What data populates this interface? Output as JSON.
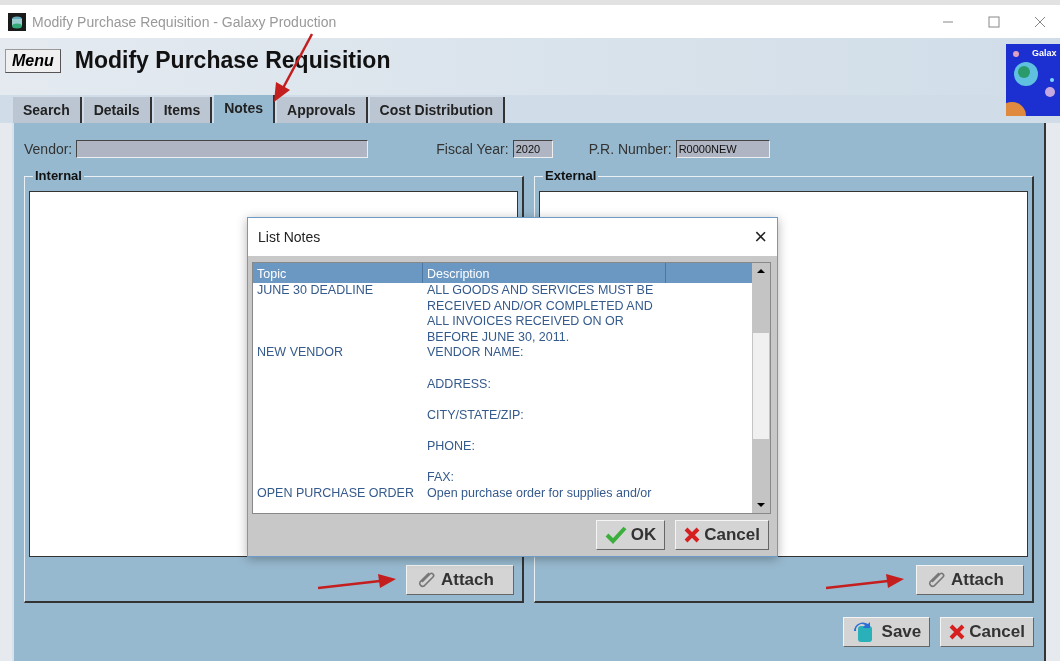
{
  "window": {
    "title": "Modify Purchase Requisition - Galaxy Production"
  },
  "header": {
    "menu_button": "Menu",
    "title": "Modify Purchase Requisition",
    "logo_text": "Galax"
  },
  "tabs": [
    {
      "label": "Search",
      "selected": false
    },
    {
      "label": "Details",
      "selected": false
    },
    {
      "label": "Items",
      "selected": false
    },
    {
      "label": "Notes",
      "selected": true
    },
    {
      "label": "Approvals",
      "selected": false
    },
    {
      "label": "Cost Distribution",
      "selected": false
    }
  ],
  "fields": {
    "vendor_label": "Vendor:",
    "fiscal_year_label": "Fiscal Year:",
    "fiscal_year": "2020",
    "pr_number_label": "P.R. Number:",
    "pr_number": "R0000NEW"
  },
  "groups": [
    {
      "title": "Internal",
      "attach": "Attach"
    },
    {
      "title": "External",
      "attach": "Attach"
    }
  ],
  "buttons": {
    "save": "Save",
    "cancel": "Cancel"
  },
  "dialog": {
    "title": "List Notes",
    "close": "×",
    "columns": [
      "Topic",
      "Description"
    ],
    "rows": [
      {
        "topic": "JUNE 30 DEADLINE",
        "description": "ALL GOODS AND SERVICES MUST BE\nRECEIVED AND/OR COMPLETED AND\nALL INVOICES RECEIVED ON OR\nBEFORE JUNE 30, 2011."
      },
      {
        "topic": "NEW VENDOR",
        "description": "VENDOR NAME:\n\nADDRESS:\n\nCITY/STATE/ZIP:\n\nPHONE:\n\nFAX:"
      },
      {
        "topic": "OPEN PURCHASE ORDER",
        "description": "Open purchase order for supplies and/or"
      }
    ],
    "ok": "OK",
    "cancel": "Cancel"
  }
}
